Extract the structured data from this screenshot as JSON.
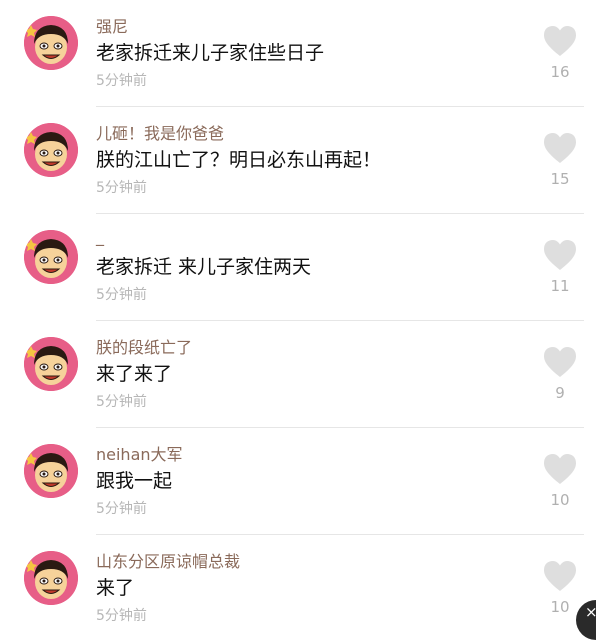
{
  "comments": [
    {
      "username": "强尼",
      "content": "老家拆迁来儿子家住些日子",
      "time": "5分钟前",
      "likes": "16"
    },
    {
      "username": "儿砸！我是你爸爸",
      "content": "朕的江山亡了？明日必东山再起！",
      "time": "5分钟前",
      "likes": "15"
    },
    {
      "username": "_",
      "content": "老家拆迁 来儿子家住两天",
      "time": "5分钟前",
      "likes": "11"
    },
    {
      "username": "朕的段纸亡了",
      "content": "来了来了",
      "time": "5分钟前",
      "likes": "9"
    },
    {
      "username": "neihan大军",
      "content": "跟我一起",
      "time": "5分钟前",
      "likes": "10"
    },
    {
      "username": "山东分区原谅帽总裁",
      "content": "来了",
      "time": "5分钟前",
      "likes": "10"
    }
  ],
  "close_icon": "close-icon",
  "close_label": "×"
}
